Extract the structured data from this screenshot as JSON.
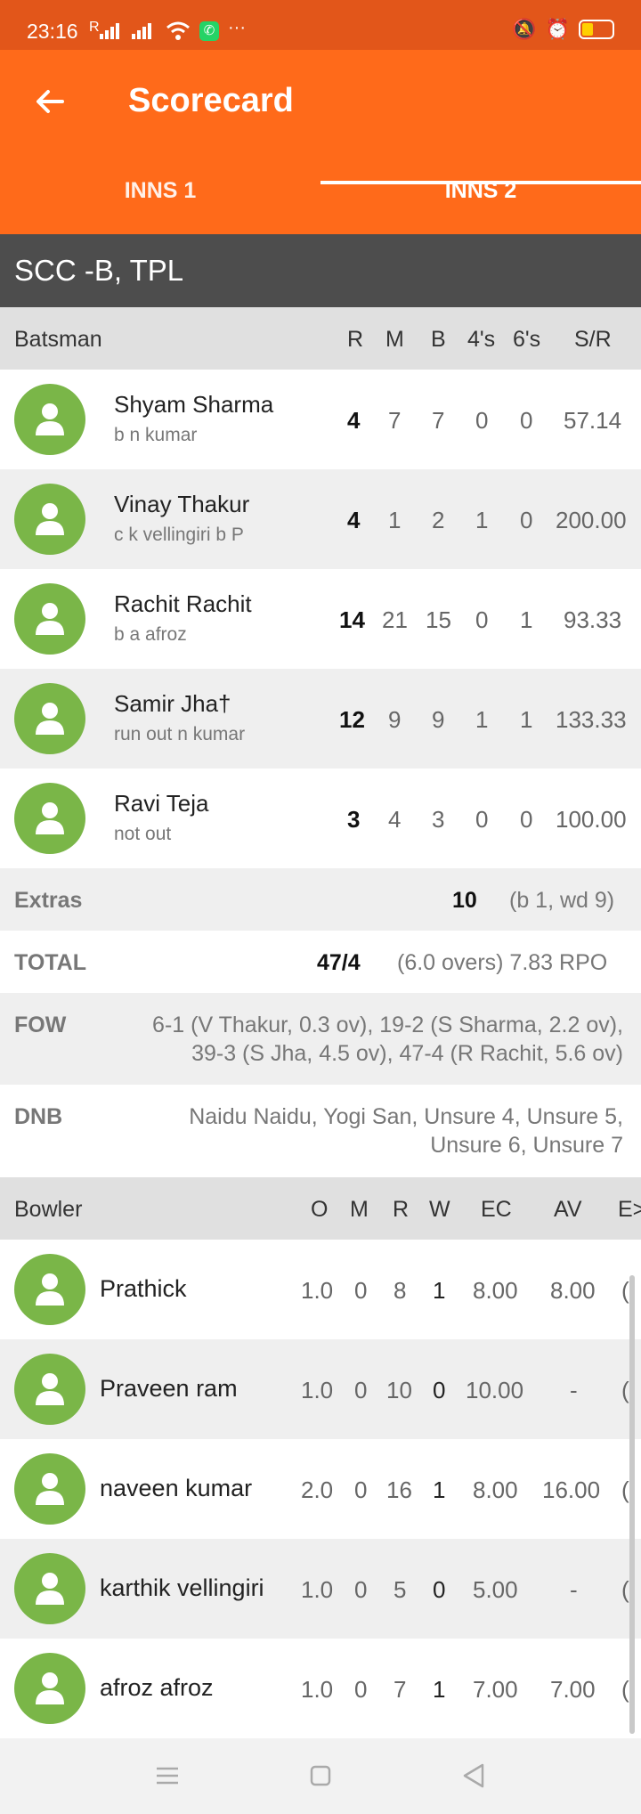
{
  "status_bar": {
    "time": "23:16",
    "signal_text": "R"
  },
  "header": {
    "title": "Scorecard",
    "tabs": [
      "INNS 1",
      "INNS 2"
    ]
  },
  "team": {
    "name": "SCC -B, TPL"
  },
  "batting": {
    "heading": "Batsman",
    "columns": [
      "R",
      "M",
      "B",
      "4's",
      "6's",
      "S/R"
    ],
    "rows": [
      {
        "name": "Shyam Sharma",
        "dismissal": "b n kumar",
        "r": "4",
        "m": "7",
        "b": "7",
        "fours": "0",
        "sixes": "0",
        "sr": "57.14"
      },
      {
        "name": "Vinay Thakur",
        "dismissal": "c k vellingiri b P",
        "r": "4",
        "m": "1",
        "b": "2",
        "fours": "1",
        "sixes": "0",
        "sr": "200.00"
      },
      {
        "name": "Rachit Rachit",
        "dismissal": "b a afroz",
        "r": "14",
        "m": "21",
        "b": "15",
        "fours": "0",
        "sixes": "1",
        "sr": "93.33"
      },
      {
        "name": "Samir Jha†",
        "dismissal": "run out n kumar",
        "r": "12",
        "m": "9",
        "b": "9",
        "fours": "1",
        "sixes": "1",
        "sr": "133.33"
      },
      {
        "name": "Ravi Teja",
        "dismissal": "not out",
        "r": "3",
        "m": "4",
        "b": "3",
        "fours": "0",
        "sixes": "0",
        "sr": "100.00"
      }
    ]
  },
  "extras": {
    "label": "Extras",
    "value": "10",
    "detail": "(b 1, wd 9)"
  },
  "total": {
    "label": "TOTAL",
    "value": "47/4",
    "detail": "(6.0 overs) 7.83 RPO"
  },
  "fow": {
    "label": "FOW",
    "line1": "6-1 (V Thakur, 0.3 ov), 19-2 (S Sharma, 2.2 ov),",
    "line2": "39-3 (S Jha, 4.5 ov), 47-4 (R Rachit, 5.6 ov)"
  },
  "dnb": {
    "label": "DNB",
    "line1": "Naidu Naidu, Yogi San, Unsure 4, Unsure 5,",
    "line2": "Unsure 6, Unsure 7"
  },
  "bowling": {
    "heading": "Bowler",
    "columns": [
      "O",
      "M",
      "R",
      "W",
      "EC",
      "AV",
      "E>"
    ],
    "rows": [
      {
        "name": "Prathick",
        "o": "1.0",
        "m": "0",
        "r": "8",
        "w": "1",
        "ec": "8.00",
        "av": "8.00",
        "ex": "("
      },
      {
        "name": "Praveen ram",
        "o": "1.0",
        "m": "0",
        "r": "10",
        "w": "0",
        "ec": "10.00",
        "av": "-",
        "ex": "("
      },
      {
        "name": "naveen kumar",
        "o": "2.0",
        "m": "0",
        "r": "16",
        "w": "1",
        "ec": "8.00",
        "av": "16.00",
        "ex": "("
      },
      {
        "name": "karthik vellingiri",
        "o": "1.0",
        "m": "0",
        "r": "5",
        "w": "0",
        "ec": "5.00",
        "av": "-",
        "ex": "("
      },
      {
        "name": "afroz afroz",
        "o": "1.0",
        "m": "0",
        "r": "7",
        "w": "1",
        "ec": "7.00",
        "av": "7.00",
        "ex": "("
      }
    ]
  },
  "colors": {
    "primary": "#ff6a1a",
    "status_bar": "#e2561a",
    "team_bar": "#4d4d4d",
    "avatar": "#7ab648"
  }
}
